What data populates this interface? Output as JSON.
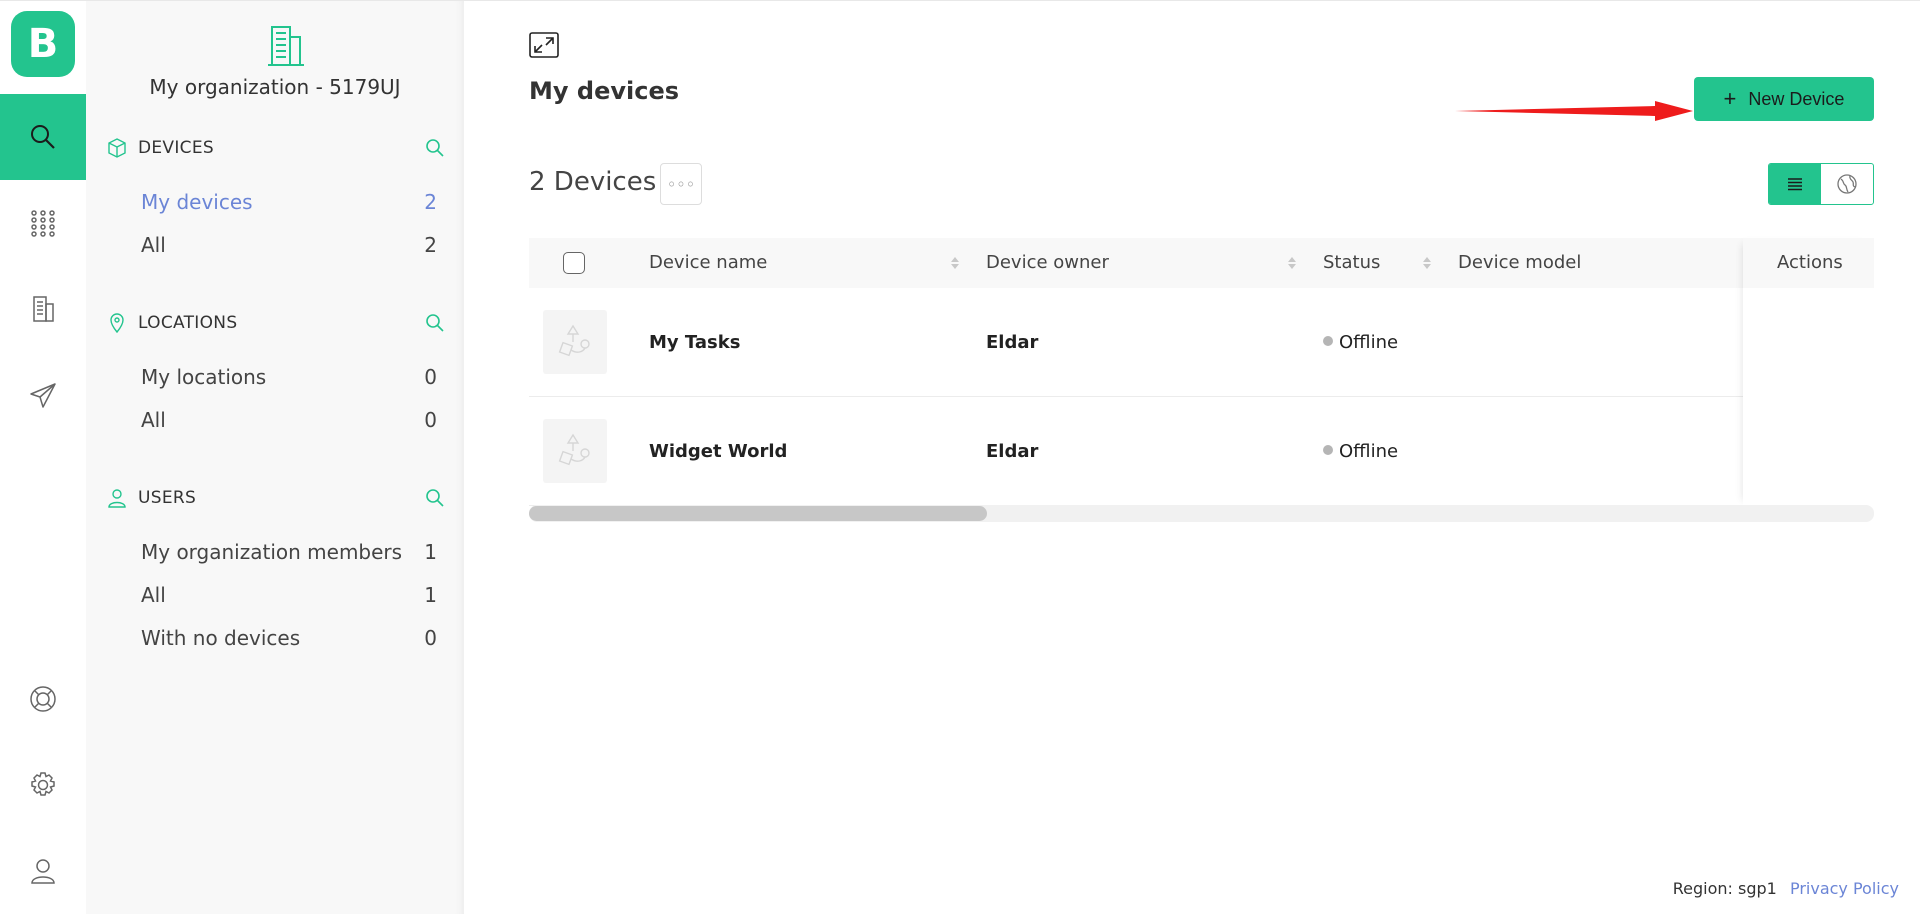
{
  "brand": {
    "logo_letter": "B",
    "accent": "#23c48e",
    "link_color": "#6b85d6"
  },
  "rail": {
    "items": [
      {
        "icon": "search-icon",
        "active": true
      },
      {
        "icon": "apps-grid-icon",
        "active": false
      },
      {
        "icon": "building-icon",
        "active": false
      },
      {
        "icon": "paper-plane-icon",
        "active": false
      }
    ],
    "bottom": [
      {
        "icon": "lifebuoy-icon"
      },
      {
        "icon": "gear-icon"
      },
      {
        "icon": "user-icon"
      }
    ]
  },
  "sidebar": {
    "org_name": "My organization - 5179UJ",
    "sections": [
      {
        "title": "DEVICES",
        "icon": "cube-icon",
        "items": [
          {
            "label": "My devices",
            "count": "2",
            "active": true
          },
          {
            "label": "All",
            "count": "2"
          }
        ]
      },
      {
        "title": "LOCATIONS",
        "icon": "map-pin-icon",
        "items": [
          {
            "label": "My locations",
            "count": "0"
          },
          {
            "label": "All",
            "count": "0"
          }
        ]
      },
      {
        "title": "USERS",
        "icon": "user-outline-icon",
        "items": [
          {
            "label": "My organization members",
            "count": "1"
          },
          {
            "label": "All",
            "count": "1"
          },
          {
            "label": "With no devices",
            "count": "0"
          }
        ]
      }
    ]
  },
  "main": {
    "title": "My devices",
    "new_button": "New Device",
    "count_label": "2 Devices",
    "more_label": "◦◦◦",
    "table": {
      "columns": [
        "Device name",
        "Device owner",
        "Status",
        "Device model",
        "Actions"
      ],
      "rows": [
        {
          "name": "My Tasks",
          "owner": "Eldar",
          "status": "Offline",
          "model": ""
        },
        {
          "name": "Widget World",
          "owner": "Eldar",
          "status": "Offline",
          "model": ""
        }
      ]
    }
  },
  "footer": {
    "region": "Region: sgp1",
    "privacy": "Privacy Policy"
  }
}
